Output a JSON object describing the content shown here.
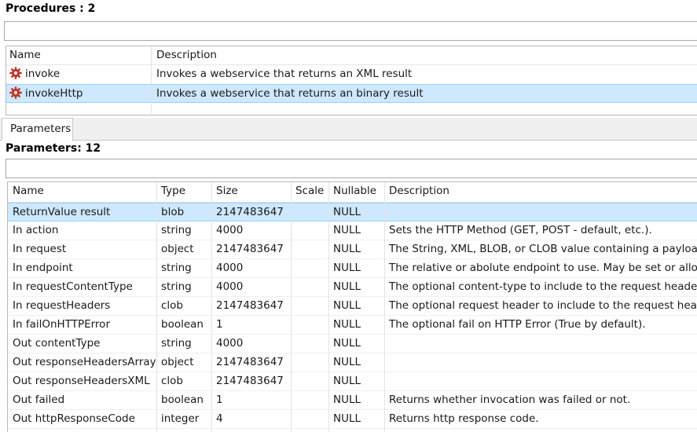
{
  "procedures": {
    "title": "Procedures : 2",
    "filter_value": "",
    "columns": [
      "Name",
      "Description"
    ],
    "rows": [
      {
        "name": "invoke",
        "description": "Invokes a webservice that returns an XML result",
        "icon": "gear-icon",
        "selected": false
      },
      {
        "name": "invokeHttp",
        "description": "Invokes a webservice that returns an binary result",
        "icon": "gear-icon",
        "selected": true
      }
    ]
  },
  "tabs": [
    {
      "label": "Parameters",
      "active": true
    }
  ],
  "parameters": {
    "title": "Parameters: 12",
    "filter_value": "",
    "columns": [
      "Name",
      "Type",
      "Size",
      "Scale",
      "Nullable",
      "Description"
    ],
    "rows": [
      {
        "name": "ReturnValue result",
        "type": "blob",
        "size": "2147483647",
        "scale": "",
        "nullable": "NULL",
        "description": "",
        "selected": true
      },
      {
        "name": "In action",
        "type": "string",
        "size": "4000",
        "scale": "",
        "nullable": "NULL",
        "description": "Sets the HTTP Method (GET, POST - default, etc.).",
        "selected": false
      },
      {
        "name": "In request",
        "type": "object",
        "size": "2147483647",
        "scale": "",
        "nullable": "NULL",
        "description": "The String, XML, BLOB, or CLOB value containing a payload",
        "selected": false
      },
      {
        "name": "In endpoint",
        "type": "string",
        "size": "4000",
        "scale": "",
        "nullable": "NULL",
        "description": "The relative or abolute endpoint to use.  May be set or allow",
        "selected": false
      },
      {
        "name": "In requestContentType",
        "type": "string",
        "size": "4000",
        "scale": "",
        "nullable": "NULL",
        "description": "The optional content-type to include to the request headers",
        "selected": false
      },
      {
        "name": "In requestHeaders",
        "type": "clob",
        "size": "2147483647",
        "scale": "",
        "nullable": "NULL",
        "description": "The optional request header to include to the request heade",
        "selected": false
      },
      {
        "name": "In failOnHTTPError",
        "type": "boolean",
        "size": "1",
        "scale": "",
        "nullable": "NULL",
        "description": "The optional fail on HTTP Error (True by default).",
        "selected": false
      },
      {
        "name": "Out contentType",
        "type": "string",
        "size": "4000",
        "scale": "",
        "nullable": "NULL",
        "description": "",
        "selected": false
      },
      {
        "name": "Out responseHeadersArray",
        "type": "object",
        "size": "2147483647",
        "scale": "",
        "nullable": "NULL",
        "description": "",
        "selected": false
      },
      {
        "name": "Out responseHeadersXML",
        "type": "clob",
        "size": "2147483647",
        "scale": "",
        "nullable": "NULL",
        "description": "",
        "selected": false
      },
      {
        "name": "Out failed",
        "type": "boolean",
        "size": "1",
        "scale": "",
        "nullable": "NULL",
        "description": "Returns whether invocation was failed or not.",
        "selected": false
      },
      {
        "name": "Out httpResponseCode",
        "type": "integer",
        "size": "4",
        "scale": "",
        "nullable": "NULL",
        "description": "Returns http response code.",
        "selected": false
      }
    ]
  },
  "colors": {
    "selection": "#cde8ff",
    "selection_border": "#99d1ff",
    "gear": "#c0392b"
  }
}
